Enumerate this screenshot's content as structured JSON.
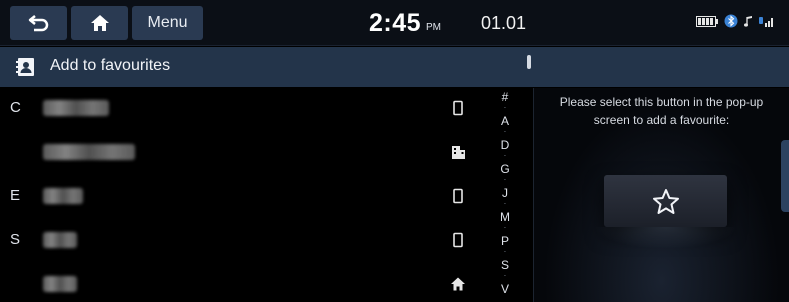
{
  "topbar": {
    "menu_label": "Menu",
    "time": "2:45",
    "ampm": "PM",
    "date": "01.01",
    "icons": [
      "battery-icon",
      "bluetooth-icon",
      "music-icon",
      "signal-icon"
    ]
  },
  "titlebar": {
    "title": "Add to favourites",
    "icon": "contact-book-icon"
  },
  "contacts": [
    {
      "letter": "C",
      "type_icon": "mobile-icon"
    },
    {
      "letter": "",
      "type_icon": "office-icon"
    },
    {
      "letter": "E",
      "type_icon": "mobile-icon"
    },
    {
      "letter": "S",
      "type_icon": "mobile-icon"
    },
    {
      "letter": "",
      "type_icon": "home-icon"
    }
  ],
  "index": [
    "#",
    "A",
    "D",
    "G",
    "J",
    "M",
    "P",
    "S",
    "V"
  ],
  "panel": {
    "hint": "Please select this button in the pop-up screen to add a favourite:",
    "button_icon": "star-icon"
  },
  "colors": {
    "topbar_bg": "#0b0f16",
    "button_bg": "#2a3a52",
    "titlebar_bg": "#23344a",
    "accent_tab": "#2c4260"
  }
}
